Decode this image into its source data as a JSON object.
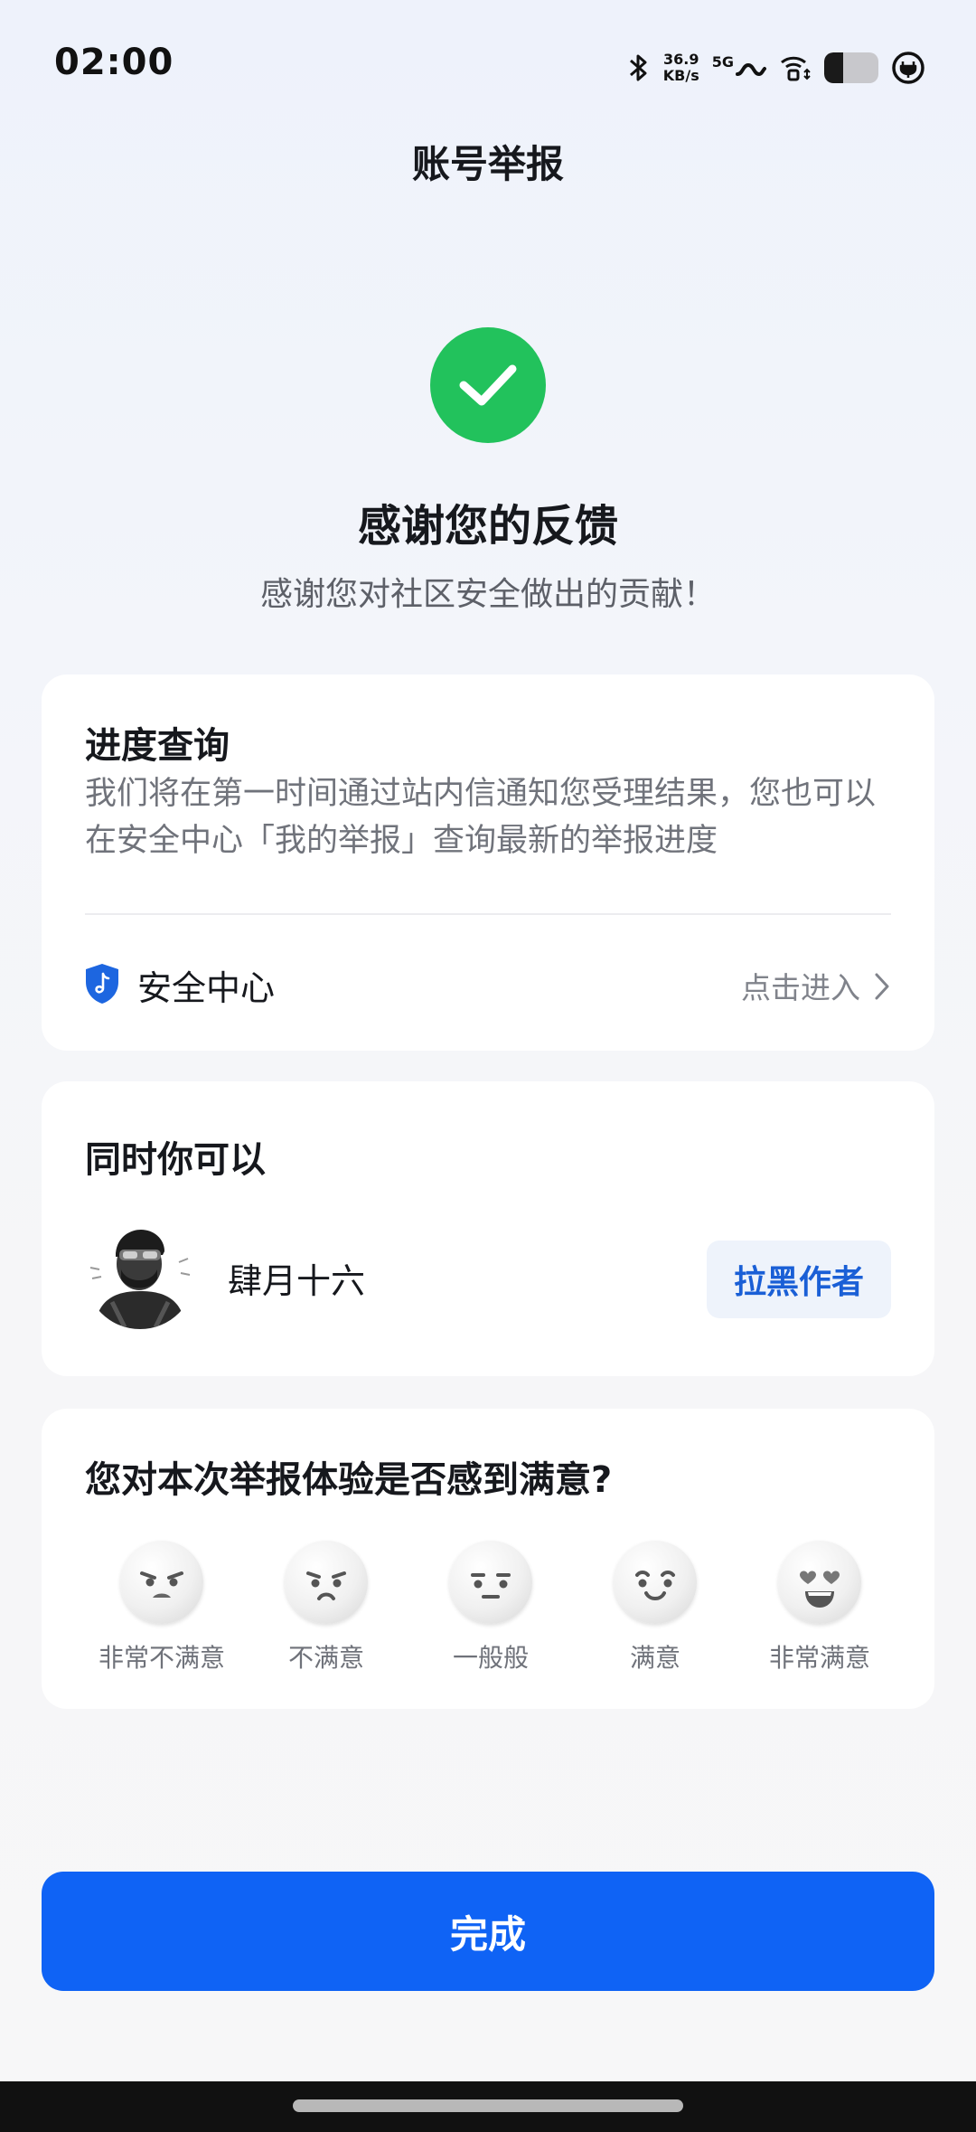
{
  "status_bar": {
    "time": "02:00",
    "net_speed_value": "36.9",
    "net_speed_unit": "KB/s",
    "network_type": "5G",
    "battery_level": 0.35
  },
  "header": {
    "title": "账号举报"
  },
  "result": {
    "title": "感谢您的反馈",
    "subtitle": "感谢您对社区安全做出的贡献！"
  },
  "progress_card": {
    "title": "进度查询",
    "description": "我们将在第一时间通过站内信通知您受理结果，您也可以在安全中心「我的举报」查询最新的举报进度",
    "security_center_label": "安全中心",
    "enter_label": "点击进入"
  },
  "actions_card": {
    "title": "同时你可以",
    "author_name": "肆月十六",
    "block_button_label": "拉黑作者"
  },
  "survey_card": {
    "title": "您对本次举报体验是否感到满意?",
    "options": [
      {
        "label": "非常不满意",
        "icon": "very-dissatisfied-face-icon"
      },
      {
        "label": "不满意",
        "icon": "dissatisfied-face-icon"
      },
      {
        "label": "一般般",
        "icon": "neutral-face-icon"
      },
      {
        "label": "满意",
        "icon": "satisfied-face-icon"
      },
      {
        "label": "非常满意",
        "icon": "very-satisfied-face-icon"
      }
    ]
  },
  "footer": {
    "done_button_label": "完成"
  },
  "colors": {
    "primary": "#0f63f5",
    "success": "#22c25c",
    "block_button_text": "#1a5fd6"
  }
}
